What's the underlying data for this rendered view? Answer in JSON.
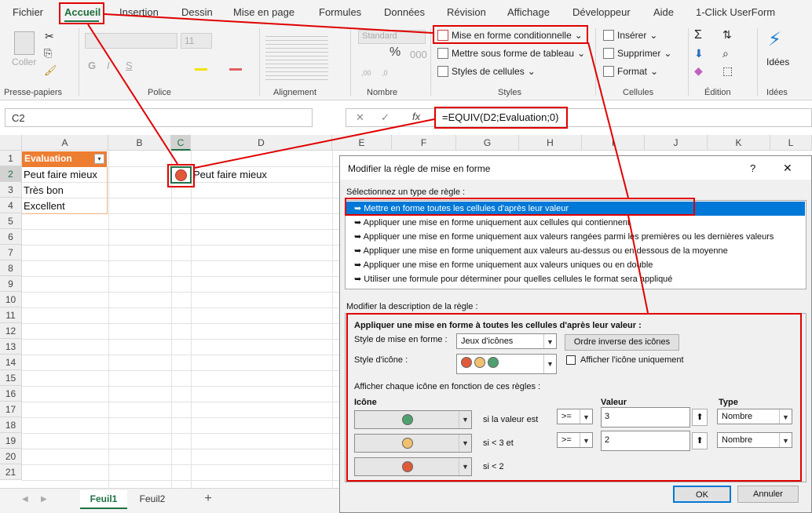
{
  "menu": {
    "tabs": [
      "Fichier",
      "Accueil",
      "Insertion",
      "Dessin",
      "Mise en page",
      "Formules",
      "Données",
      "Révision",
      "Affichage",
      "Développeur",
      "Aide",
      "1-Click UserForm"
    ]
  },
  "ribbon": {
    "clipboard": {
      "paste_label": "Coller",
      "group_label": "Presse-papiers"
    },
    "font": {
      "font_size": "11",
      "group_label": "Police",
      "bold": "G",
      "italic": "I",
      "underline": "S"
    },
    "alignment": {
      "group_label": "Alignement"
    },
    "number": {
      "format": "Standard",
      "group_label": "Nombre"
    },
    "styles": {
      "conditional_format": "Mise en forme conditionnelle",
      "format_as_table": "Mettre sous forme de tableau",
      "cell_styles": "Styles de cellules",
      "group_label": "Styles"
    },
    "cells": {
      "insert": "Insérer",
      "delete": "Supprimer",
      "format": "Format",
      "group_label": "Cellules"
    },
    "editing": {
      "group_label": "Édition"
    },
    "ideas": {
      "label": "Idées",
      "group_label": "Idées"
    }
  },
  "formula_bar": {
    "name_box": "C2",
    "formula": "=EQUIV(D2;Evaluation;0)",
    "fx": "fx"
  },
  "sheet": {
    "columns": [
      "A",
      "B",
      "C",
      "D",
      "E",
      "F",
      "G",
      "H",
      "I",
      "J",
      "K",
      "L"
    ],
    "rows": [
      "1",
      "2",
      "3",
      "4",
      "5",
      "6",
      "7",
      "8",
      "9",
      "10",
      "11",
      "12",
      "13",
      "14",
      "15",
      "16",
      "17",
      "18",
      "19",
      "20",
      "21"
    ],
    "header_cell": "Evaluation",
    "a2": "Peut faire mieux",
    "a3": "Très bon",
    "a4": "Excellent",
    "d2": "Peut faire mieux",
    "tabs": [
      "Feuil1",
      "Feuil2"
    ],
    "add_sheet": "+"
  },
  "dialog": {
    "title": "Modifier la règle de mise en forme",
    "help": "?",
    "close": "✕",
    "select_type_label": "Sélectionnez un type de règle :",
    "rule_types": [
      "Mettre en forme toutes les cellules d'après leur valeur",
      "Appliquer une mise en forme uniquement aux cellules qui contiennent",
      "Appliquer une mise en forme uniquement aux valeurs rangées parmi les premières ou les dernières valeurs",
      "Appliquer une mise en forme uniquement aux valeurs au-dessus ou en dessous de la moyenne",
      "Appliquer une mise en forme uniquement aux valeurs uniques ou en double",
      "Utiliser une formule pour déterminer pour quelles cellules le format sera appliqué"
    ],
    "edit_desc_label": "Modifier la description de la règle :",
    "desc_heading": "Appliquer une mise en forme à toutes les cellules d'après leur valeur :",
    "format_style_label": "Style de mise en forme :",
    "format_style_value": "Jeux d'icônes",
    "reverse_order_button": "Ordre inverse des icônes",
    "icon_style_label": "Style d'icône :",
    "show_icon_only_label": "Afficher l'icône uniquement",
    "rules_intro": "Afficher chaque icône en fonction de ces règles :",
    "col_icon": "Icône",
    "col_value": "Valeur",
    "col_type": "Type",
    "icon_rows": [
      {
        "color": "#4fa06f",
        "text": "si la valeur est",
        "op": ">=",
        "value": "3",
        "type": "Nombre"
      },
      {
        "color": "#f0c070",
        "text": "si < 3 et",
        "op": ">=",
        "value": "2",
        "type": "Nombre"
      },
      {
        "color": "#e05a3a",
        "text": "si < 2"
      }
    ],
    "ok": "OK",
    "cancel": "Annuler"
  },
  "colors": {
    "excel_green": "#1e7145",
    "header_orange": "#ed7d31",
    "highlight_red": "#e00000",
    "selection_blue": "#0078d7"
  }
}
